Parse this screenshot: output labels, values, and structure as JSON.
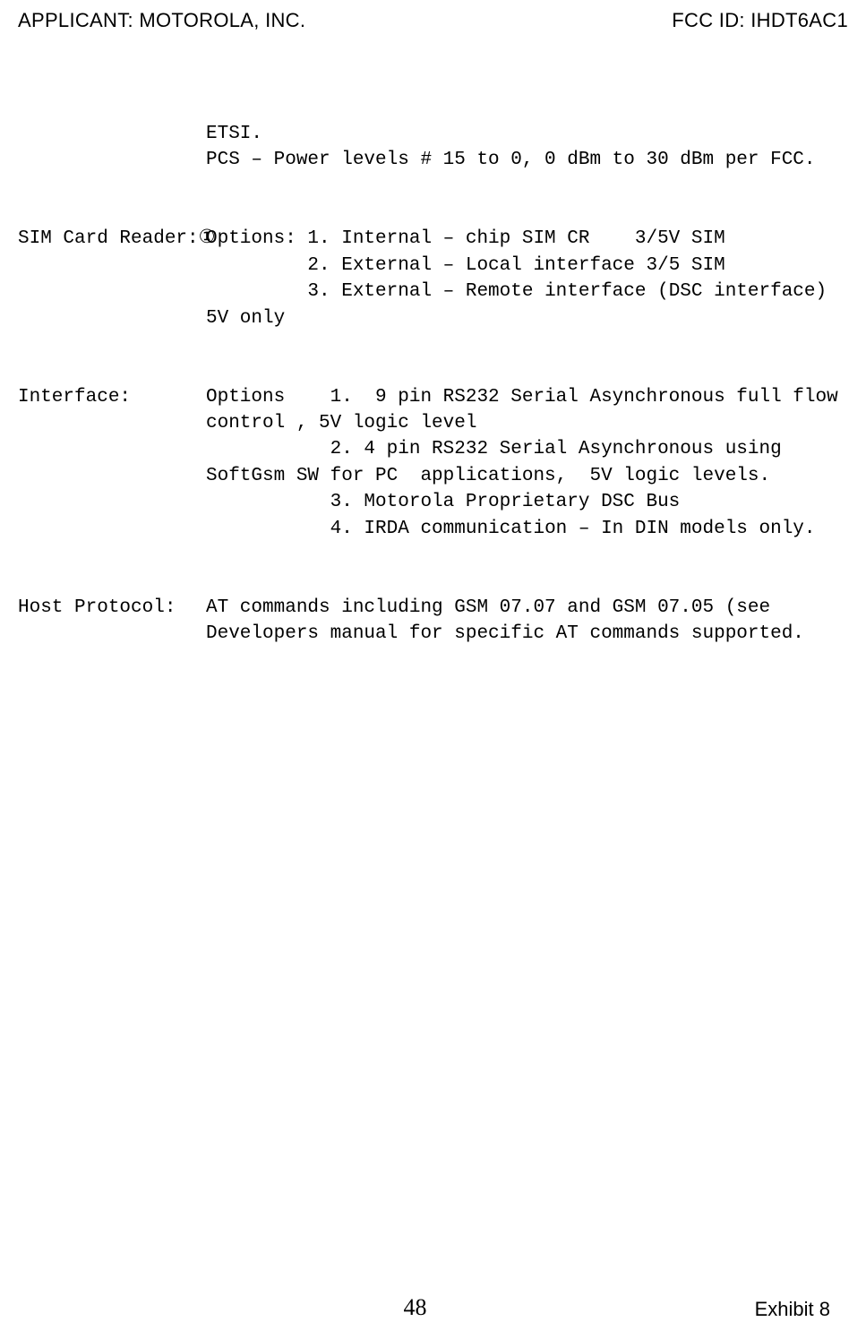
{
  "header": {
    "applicant_label": "APPLICANT:  MOTOROLA, INC.",
    "fcc_id": "FCC ID: IHDT6AC1"
  },
  "rows": [
    {
      "label": "",
      "value": "ETSI.\nPCS – Power levels # 15 to 0, 0 dBm to 30 dBm per FCC."
    },
    {
      "label": "SIM Card Reader:①",
      "value": "Options: 1. Internal – chip SIM CR    3/5V SIM\n         2. External – Local interface 3/5 SIM\n         3. External – Remote interface (DSC interface) 5V only"
    },
    {
      "label": "Interface:",
      "value": "Options    1.  9 pin RS232 Serial Asynchronous full flow control , 5V logic level\n           2. 4 pin RS232 Serial Asynchronous using  SoftGsm SW for PC  applications,  5V logic levels.\n           3. Motorola Proprietary DSC Bus\n           4. IRDA communication – In DIN models only."
    },
    {
      "label": "Host Protocol:",
      "value": "AT commands including GSM 07.07 and GSM 07.05 (see Developers manual for specific AT commands supported."
    }
  ],
  "footer": {
    "page_number": "48",
    "exhibit": "Exhibit 8"
  }
}
